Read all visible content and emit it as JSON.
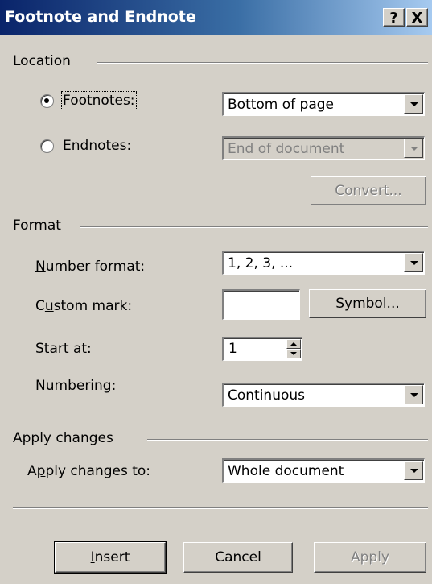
{
  "window": {
    "title": "Footnote and Endnote",
    "help_glyph": "?",
    "close_glyph": "X"
  },
  "location": {
    "group_label": "Location",
    "footnotes": {
      "label_accel": "F",
      "label_rest": "ootnotes:",
      "selected": true,
      "position": "Bottom of page"
    },
    "endnotes": {
      "label_accel": "E",
      "label_rest": "ndnotes:",
      "selected": false,
      "position": "End of document"
    },
    "convert_label": "Convert..."
  },
  "format": {
    "group_label": "Format",
    "number_format": {
      "label_accel": "N",
      "label_rest": "umber format:",
      "value": "1, 2, 3, ..."
    },
    "custom_mark": {
      "label_pre": "C",
      "label_accel": "u",
      "label_rest": "stom mark:",
      "value": ""
    },
    "symbol_button": {
      "pre": "S",
      "accel": "y",
      "rest": "mbol..."
    },
    "start_at": {
      "label_accel": "S",
      "label_rest": "tart at:",
      "value": "1"
    },
    "numbering": {
      "label_pre": "Nu",
      "label_accel": "m",
      "label_rest": "bering:",
      "value": "Continuous"
    }
  },
  "apply_changes": {
    "group_label": "Apply changes",
    "apply_to": {
      "label_pre": "A",
      "label_accel": "p",
      "label_rest": "ply changes to:",
      "value": "Whole document"
    }
  },
  "buttons": {
    "insert": {
      "accel": "I",
      "rest": "nsert"
    },
    "cancel": "Cancel",
    "apply": "Apply"
  },
  "colors": {
    "dialog_bg": "#d4d0c8",
    "title_start": "#0a246a",
    "title_end": "#a6caf0",
    "disabled_text": "#808080"
  }
}
